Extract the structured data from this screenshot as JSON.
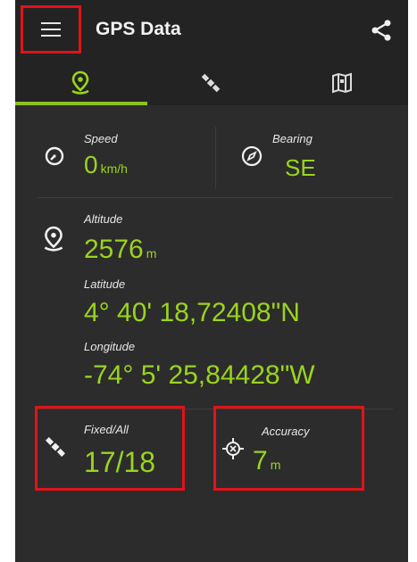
{
  "header": {
    "title": "GPS Data",
    "menu_icon": "hamburger-menu-icon",
    "share_icon": "share-icon"
  },
  "tabs": [
    {
      "name": "location",
      "icon": "location-pin-icon",
      "selected": true
    },
    {
      "name": "satellites",
      "icon": "satellite-icon",
      "selected": false
    },
    {
      "name": "map",
      "icon": "map-icon",
      "selected": false
    }
  ],
  "speed": {
    "label": "Speed",
    "value": "0",
    "unit": "km/h"
  },
  "bearing": {
    "label": "Bearing",
    "value": "SE"
  },
  "altitude": {
    "label": "Altitude",
    "value": "2576",
    "unit": "m"
  },
  "latitude": {
    "label": "Latitude",
    "value": "4° 40' 18,72408\"N"
  },
  "longitude": {
    "label": "Longitude",
    "value": "-74° 5' 25,84428\"W"
  },
  "fixed": {
    "label": "Fixed/All",
    "value": "17/18"
  },
  "accuracy": {
    "label": "Accuracy",
    "value": "7",
    "unit": "m"
  },
  "colors": {
    "accent": "#9ad41e",
    "highlight": "#e0141a",
    "background": "#2c2c2c",
    "bar": "#232323"
  }
}
